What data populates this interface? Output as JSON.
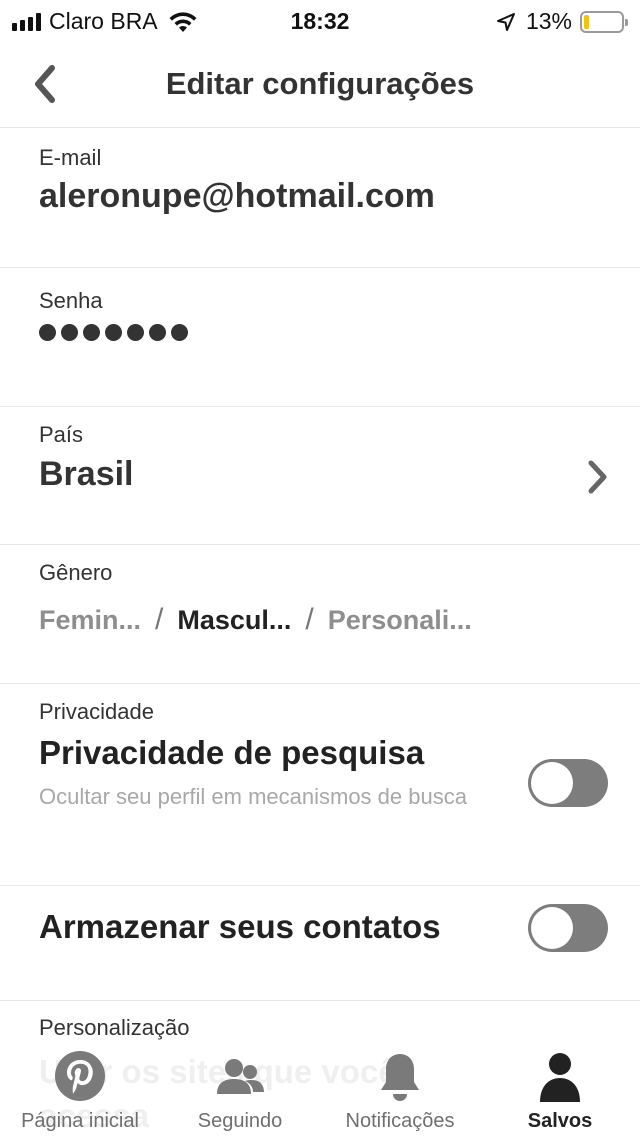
{
  "status_bar": {
    "carrier": "Claro BRA",
    "time": "18:32",
    "battery_percent": "13%",
    "battery_level": 0.13
  },
  "header": {
    "title": "Editar configurações"
  },
  "email": {
    "label": "E-mail",
    "value": "aleronupe@hotmail.com"
  },
  "password": {
    "label": "Senha",
    "masked_length": 7
  },
  "country": {
    "label": "País",
    "value": "Brasil"
  },
  "gender": {
    "label": "Gênero",
    "options": [
      "Femin...",
      "Mascul...",
      "Personali..."
    ],
    "selected": "Mascul...",
    "separator": "/"
  },
  "privacy": {
    "section_label": "Privacidade",
    "title": "Privacidade de pesquisa",
    "description": "Ocultar seu perfil em mecanismos de busca",
    "enabled": false
  },
  "contacts": {
    "title": "Armazenar seus contatos",
    "enabled": false
  },
  "personalization": {
    "section_label": "Personalização",
    "partial_title_line1": "Usar os sites que você",
    "partial_title_line2": "acessa"
  },
  "tab_bar": {
    "items": [
      {
        "label": "Página inicial",
        "icon": "pinterest-logo-icon"
      },
      {
        "label": "Seguindo",
        "icon": "people-icon"
      },
      {
        "label": "Notificações",
        "icon": "bell-icon"
      },
      {
        "label": "Salvos",
        "icon": "profile-icon",
        "active": true
      }
    ]
  },
  "colors": {
    "text_primary": "#222222",
    "text_muted": "#8e8e8e",
    "toggle_off": "#7d7d7d",
    "pinterest_gray": "#7a7a7a",
    "battery_low": "#f4c10f"
  }
}
